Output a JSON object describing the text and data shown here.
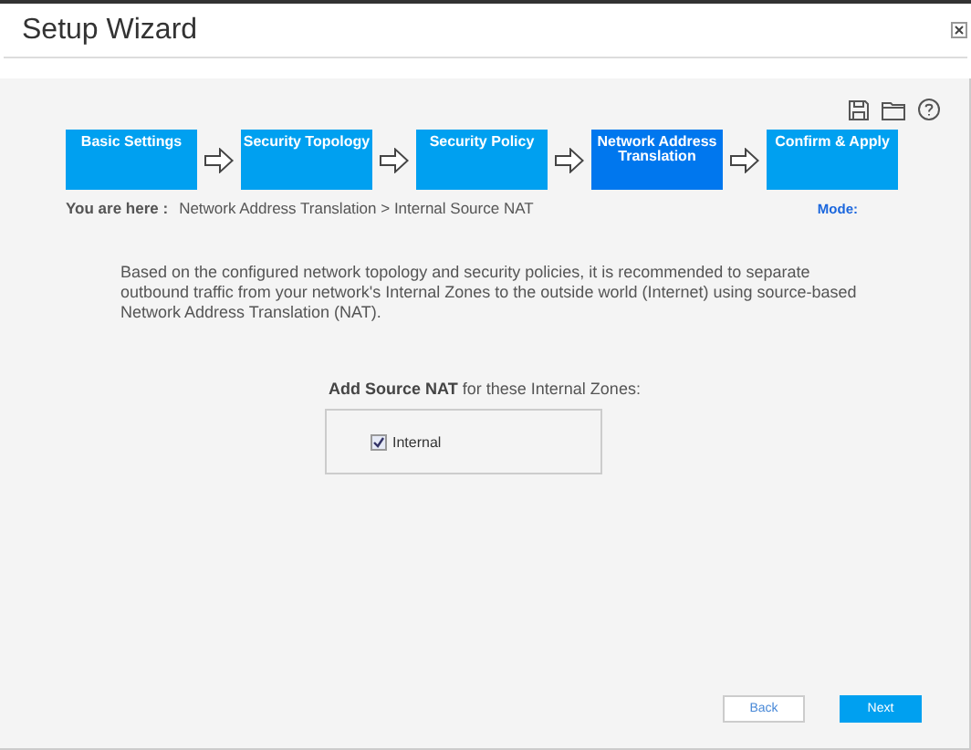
{
  "window": {
    "title": "Setup Wizard"
  },
  "steps": [
    {
      "label": "Basic Settings",
      "selected": false
    },
    {
      "label": "Security Topology",
      "selected": false
    },
    {
      "label": "Security Policy",
      "selected": false
    },
    {
      "label": "Network Address Translation",
      "selected": true
    },
    {
      "label": "Confirm & Apply",
      "selected": false
    }
  ],
  "breadcrumb": {
    "label": "You are here :",
    "path": "Network Address Translation > Internal Source NAT"
  },
  "mode": {
    "label": "Mode:"
  },
  "description": "Based on the configured network topology and security policies, it is recommended to separate outbound traffic from your network's Internal Zones to the outside world (Internet) using source-based Network Address Translation (NAT).",
  "zones": {
    "heading": "**Add Source NAT** for these Internal Zones:",
    "items": [
      {
        "label": "Internal",
        "checked": true
      }
    ]
  },
  "buttons": [
    {
      "label": "Back",
      "kind": "secondary"
    },
    {
      "label": "Next",
      "kind": "primary"
    }
  ]
}
